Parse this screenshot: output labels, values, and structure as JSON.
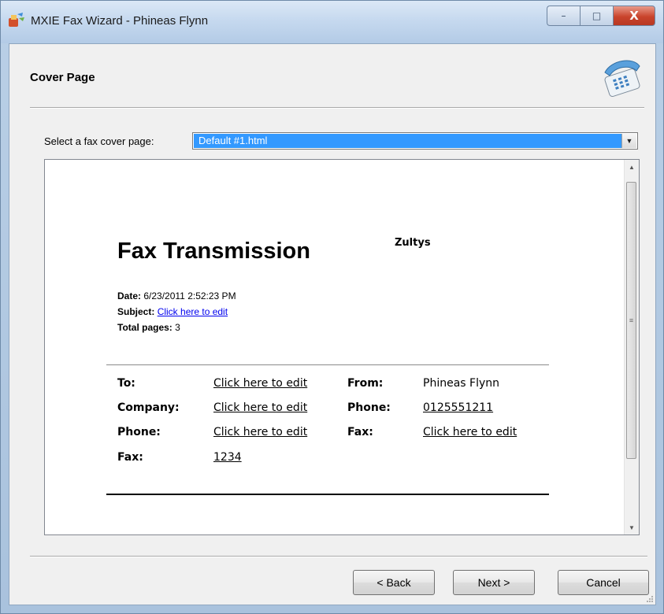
{
  "window": {
    "title": "MXIE Fax Wizard - Phineas Flynn",
    "controls": {
      "minimize": "–",
      "maximize": "□",
      "close": "X"
    },
    "icons": {
      "app": "fax-wizard-icon",
      "header": "fax-telephone-icon"
    }
  },
  "header": {
    "title": "Cover Page"
  },
  "cover_select": {
    "label": "Select a fax cover page:",
    "value": "Default #1.html"
  },
  "preview": {
    "heading": "Fax Transmission",
    "company": "Zultys",
    "date_label": "Date:",
    "date_value": "6/23/2011 2:52:23 PM",
    "subject_label": "Subject:",
    "subject_value": "Click here to edit",
    "total_label": "Total pages:",
    "total_value": "3",
    "recipient": {
      "to_label": "To:",
      "to_value": "Click here to edit",
      "company_label": "Company:",
      "company_value": "Click here to edit",
      "phone_label": "Phone:",
      "phone_value": "Click here to edit",
      "fax_label": "Fax:",
      "fax_value": "1234"
    },
    "sender": {
      "from_label": "From:",
      "from_value": "Phineas Flynn",
      "phone_label": "Phone:",
      "phone_value": "0125551211",
      "fax_label": "Fax:",
      "fax_value": "Click here to edit"
    }
  },
  "buttons": {
    "back": "< Back",
    "next": "Next >",
    "cancel": "Cancel"
  },
  "colors": {
    "selection": "#3399ff",
    "link": "#0000ee",
    "close_button": "#c9442c"
  }
}
